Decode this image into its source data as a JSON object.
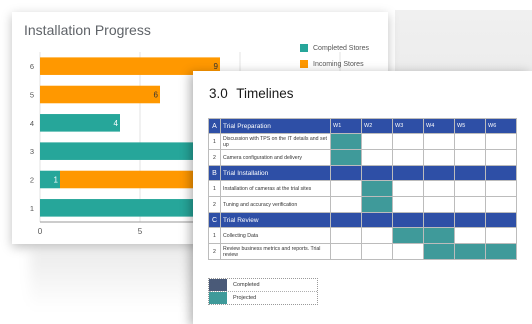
{
  "colors": {
    "completed_stores": "#26a69a",
    "incoming_stores": "#ff9800",
    "timeline_header": "#2e4fa6",
    "timeline_projected": "#3f9a9a",
    "timeline_completed": "#4a5a78"
  },
  "chart": {
    "title": "Installation Progress",
    "legend": [
      "Completed Stores",
      "Incoming Stores"
    ]
  },
  "chart_data": {
    "type": "bar",
    "orientation": "horizontal",
    "stacked": true,
    "title": "Installation Progress",
    "categories": [
      "6",
      "5",
      "4",
      "3",
      "2",
      "1"
    ],
    "series": [
      {
        "name": "Completed Stores",
        "values": [
          0,
          0,
          4,
          10,
          1,
          15
        ]
      },
      {
        "name": "Incoming Stores",
        "values": [
          9,
          6,
          0,
          0,
          8,
          0
        ]
      }
    ],
    "data_labels": [
      [
        "",
        "",
        "4",
        "10",
        "1",
        ""
      ],
      [
        "9",
        "6",
        "",
        "",
        "8",
        ""
      ]
    ],
    "xticks": [
      "0",
      "5",
      "10",
      "1"
    ],
    "xlim": [
      0,
      15
    ],
    "legend_position": "right",
    "grid": true
  },
  "timeline": {
    "number": "3.0",
    "title": "Timelines",
    "weeks": [
      "W1",
      "W2",
      "W3",
      "W4",
      "W5",
      "W6"
    ],
    "sections": [
      {
        "letter": "A",
        "name": "Trial Preparation",
        "rows": [
          {
            "n": "1",
            "text": "Discussion with TPS on the IT details and set up",
            "on": [
              1,
              0,
              0,
              0,
              0,
              0
            ]
          },
          {
            "n": "2",
            "text": "Camera configuration and delivery",
            "on": [
              1,
              0,
              0,
              0,
              0,
              0
            ]
          }
        ]
      },
      {
        "letter": "B",
        "name": "Trial Installation",
        "rows": [
          {
            "n": "1",
            "text": "Installation of cameras at the trial sites",
            "on": [
              0,
              1,
              0,
              0,
              0,
              0
            ]
          },
          {
            "n": "2",
            "text": "Tuning and accuracy verification",
            "on": [
              0,
              1,
              0,
              0,
              0,
              0
            ]
          }
        ]
      },
      {
        "letter": "C",
        "name": "Trial Review",
        "rows": [
          {
            "n": "1",
            "text": "Collecting Data",
            "on": [
              0,
              0,
              1,
              1,
              0,
              0
            ]
          },
          {
            "n": "2",
            "text": "Review business metrics and reports. Trial review",
            "on": [
              0,
              0,
              0,
              1,
              1,
              1
            ]
          }
        ]
      }
    ],
    "legend": [
      {
        "label": "Completed",
        "color": "#4a5a78"
      },
      {
        "label": "Projected",
        "color": "#3f9a9a"
      }
    ]
  }
}
